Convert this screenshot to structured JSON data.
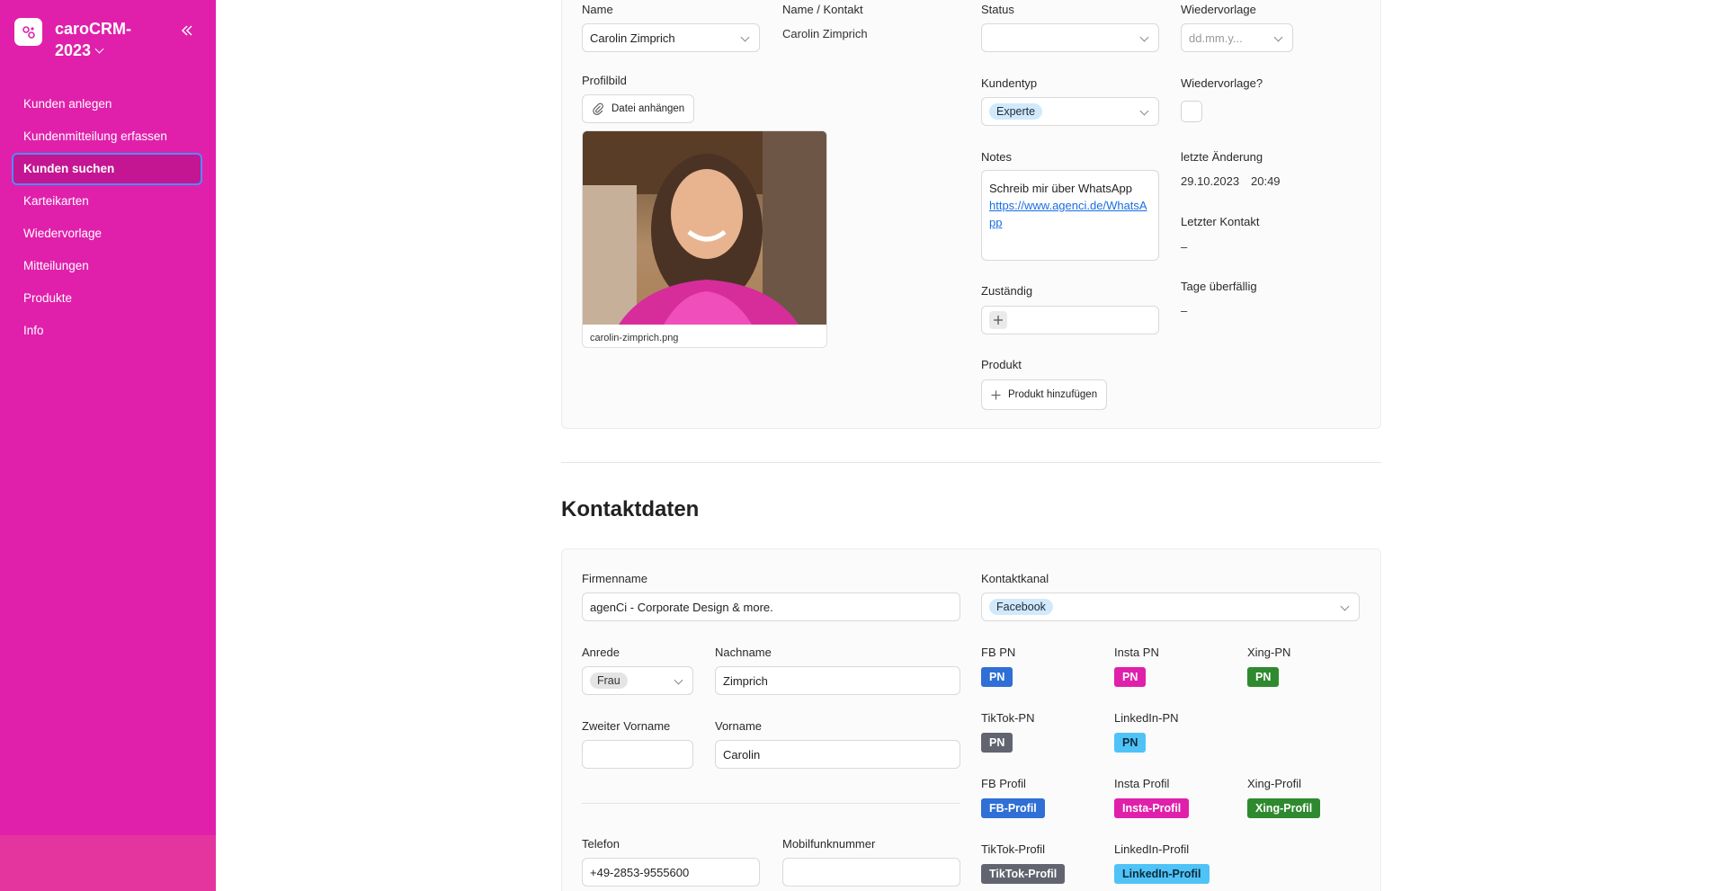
{
  "workspace": {
    "name": "caroCRM-2023"
  },
  "nav": [
    {
      "label": "Kunden anlegen",
      "active": false
    },
    {
      "label": "Kundenmitteilung erfassen",
      "active": false
    },
    {
      "label": "Kunden suchen",
      "active": true
    },
    {
      "label": "Karteikarten",
      "active": false
    },
    {
      "label": "Wiedervorlage",
      "active": false
    },
    {
      "label": "Mitteilungen",
      "active": false
    },
    {
      "label": "Produkte",
      "active": false
    },
    {
      "label": "Info",
      "active": false
    }
  ],
  "top": {
    "name_label": "Name",
    "name_value": "Carolin Zimprich",
    "name_kontakt_label": "Name / Kontakt",
    "name_kontakt_value": "Carolin Zimprich",
    "status_label": "Status",
    "status_value": "",
    "wiedervorlage_label": "Wiedervorlage",
    "wiedervorlage_placeholder": "dd.mm.y...",
    "profilbild_label": "Profilbild",
    "attach_label": "Datei anhängen",
    "photo_filename": "carolin-zimprich.png",
    "kundentyp_label": "Kundentyp",
    "kundentyp_value": "Experte",
    "wiedervorlage_q_label": "Wiedervorlage?",
    "notes_label": "Notes",
    "notes_text": "Schreib mir über WhatsApp",
    "notes_link": "https://www.agenci.de/WhatsApp",
    "letzte_aenderung_label": "letzte Änderung",
    "letzte_aenderung_date": "29.10.2023",
    "letzte_aenderung_time": "20:49",
    "letzter_kontakt_label": "Letzter Kontakt",
    "letzter_kontakt_value": "–",
    "zustaendig_label": "Zuständig",
    "tage_label": "Tage überfällig",
    "tage_value": "–",
    "produkt_label": "Produkt",
    "produkt_add_label": "Produkt hinzufügen"
  },
  "kontakt": {
    "title": "Kontaktdaten",
    "firmenname_label": "Firmenname",
    "firmenname_value": "agenCi - Corporate Design & more.",
    "kontaktkanal_label": "Kontaktkanal",
    "kontaktkanal_value": "Facebook",
    "anrede_label": "Anrede",
    "anrede_value": "Frau",
    "nachname_label": "Nachname",
    "nachname_value": "Zimprich",
    "zweiter_vorname_label": "Zweiter Vorname",
    "zweiter_vorname_value": "",
    "vorname_label": "Vorname",
    "vorname_value": "Carolin",
    "telefon_label": "Telefon",
    "telefon_value": "+49-2853-9555600",
    "mobil_label": "Mobilfunknummer",
    "mobil_value": "",
    "social": [
      {
        "label": "FB PN",
        "button": "PN",
        "style": "fb"
      },
      {
        "label": "Insta PN",
        "button": "PN",
        "style": "insta"
      },
      {
        "label": "Xing-PN",
        "button": "PN",
        "style": "xing"
      },
      {
        "label": "TikTok-PN",
        "button": "PN",
        "style": "tiktok"
      },
      {
        "label": "LinkedIn-PN",
        "button": "PN",
        "style": "linkedin"
      },
      {
        "label": "FB Profil",
        "button": "FB-Profil",
        "style": "fb"
      },
      {
        "label": "Insta Profil",
        "button": "Insta-Profil",
        "style": "insta"
      },
      {
        "label": "Xing-Profil",
        "button": "Xing-Profil",
        "style": "xing"
      },
      {
        "label": "TikTok-Profil",
        "button": "TikTok-Profil",
        "style": "tiktok"
      },
      {
        "label": "LinkedIn-Profil",
        "button": "LinkedIn-Profil",
        "style": "linkedin"
      }
    ]
  },
  "colors": {
    "sidebar": "#e020ab",
    "accent_focus": "#4f8bff",
    "fb": "#2f6fd6",
    "insta": "#e020ab",
    "xing": "#2f8a2f",
    "tiktok": "#626570",
    "linkedin": "#4fc3f7"
  }
}
